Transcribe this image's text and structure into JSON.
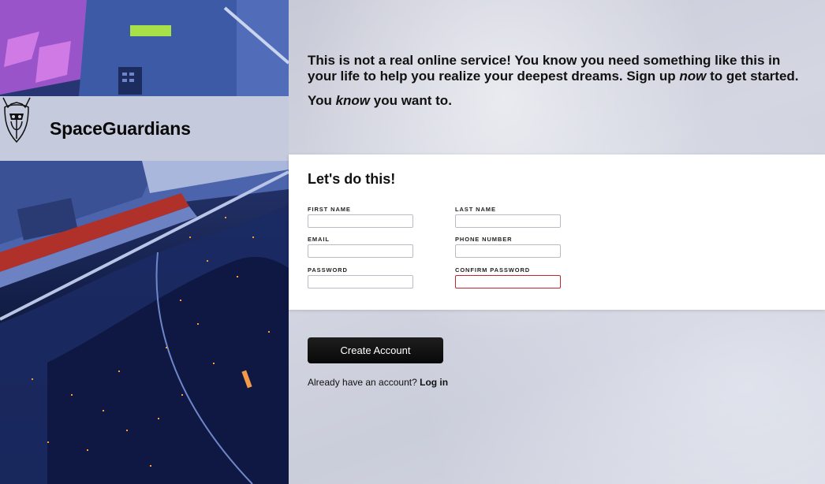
{
  "brand": {
    "name": "SpaceGuardians",
    "logo_icon": "viking-helmet-icon"
  },
  "intro": {
    "line1_pre": "This is not a real online service! You know you need something like this in your life to help you realize your deepest dreams. Sign up ",
    "line1_em": "now",
    "line1_post": " to get started.",
    "line2_pre": "You ",
    "line2_em": "know",
    "line2_post": " you want to."
  },
  "form": {
    "heading": "Let's do this!",
    "fields": {
      "first_name": {
        "label": "First Name",
        "value": ""
      },
      "last_name": {
        "label": "Last Name",
        "value": ""
      },
      "email": {
        "label": "Email",
        "value": ""
      },
      "phone": {
        "label": "Phone Number",
        "value": ""
      },
      "password": {
        "label": "Password",
        "value": ""
      },
      "confirm_password": {
        "label": "Confirm Password",
        "value": "",
        "state": "error"
      }
    }
  },
  "actions": {
    "create_label": "Create Account",
    "login_prompt": "Already have an account?",
    "login_link": "Log in"
  },
  "colors": {
    "error_border": "#c0282b",
    "button_bg": "#0d0d0d",
    "card_bg": "#ffffff"
  }
}
